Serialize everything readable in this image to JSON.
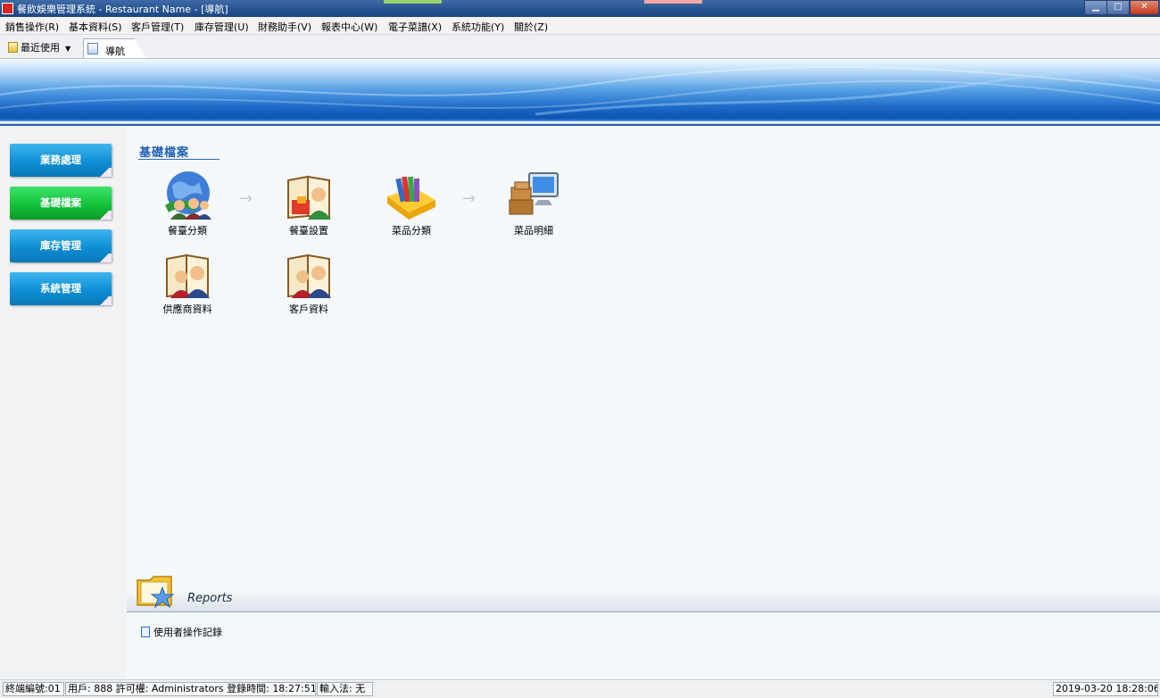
{
  "window": {
    "title": "餐飲娛樂管理系統 - Restaurant Name - [導航]",
    "minimize": "▁",
    "maximize": "□",
    "close": "✕"
  },
  "menu": [
    "銷售操作(R)",
    "基本資料(S)",
    "客戶管理(T)",
    "庫存管理(U)",
    "財務助手(V)",
    "報表中心(W)",
    "電子菜譜(X)",
    "系統功能(Y)",
    "關於(Z)"
  ],
  "toolbar": {
    "recent_label": "最近使用",
    "tab_label": "導航"
  },
  "sidebar": [
    {
      "label": "業務處理",
      "active": false
    },
    {
      "label": "基礎檔案",
      "active": true
    },
    {
      "label": "庫存管理",
      "active": false
    },
    {
      "label": "系統管理",
      "active": false
    }
  ],
  "section": {
    "title": "基礎檔案",
    "items": [
      {
        "label": "餐臺分類",
        "icon": "globe-users-icon"
      },
      {
        "label": "餐臺設置",
        "icon": "book-user-icon"
      },
      {
        "label": "菜品分類",
        "icon": "books-tray-icon"
      },
      {
        "label": "菜品明細",
        "icon": "boxes-monitor-icon"
      },
      {
        "label": "供應商資料",
        "icon": "book-users-icon"
      },
      {
        "label": "客戶資料",
        "icon": "book-users-icon"
      }
    ]
  },
  "reports": {
    "title": "Reports",
    "links": [
      "使用者操作記錄"
    ]
  },
  "status": {
    "terminal": "終端編號:01",
    "user": "用戶: 888 許可權: Administrators 登錄時間: 18:27:51",
    "input_method": "輸入法: 无",
    "datetime": "2019-03-20 18:28:06"
  },
  "colors": {
    "sidebar_button": "#0d8ed5",
    "sidebar_button_active": "#14c23a",
    "section_title": "#1f5fb1"
  }
}
